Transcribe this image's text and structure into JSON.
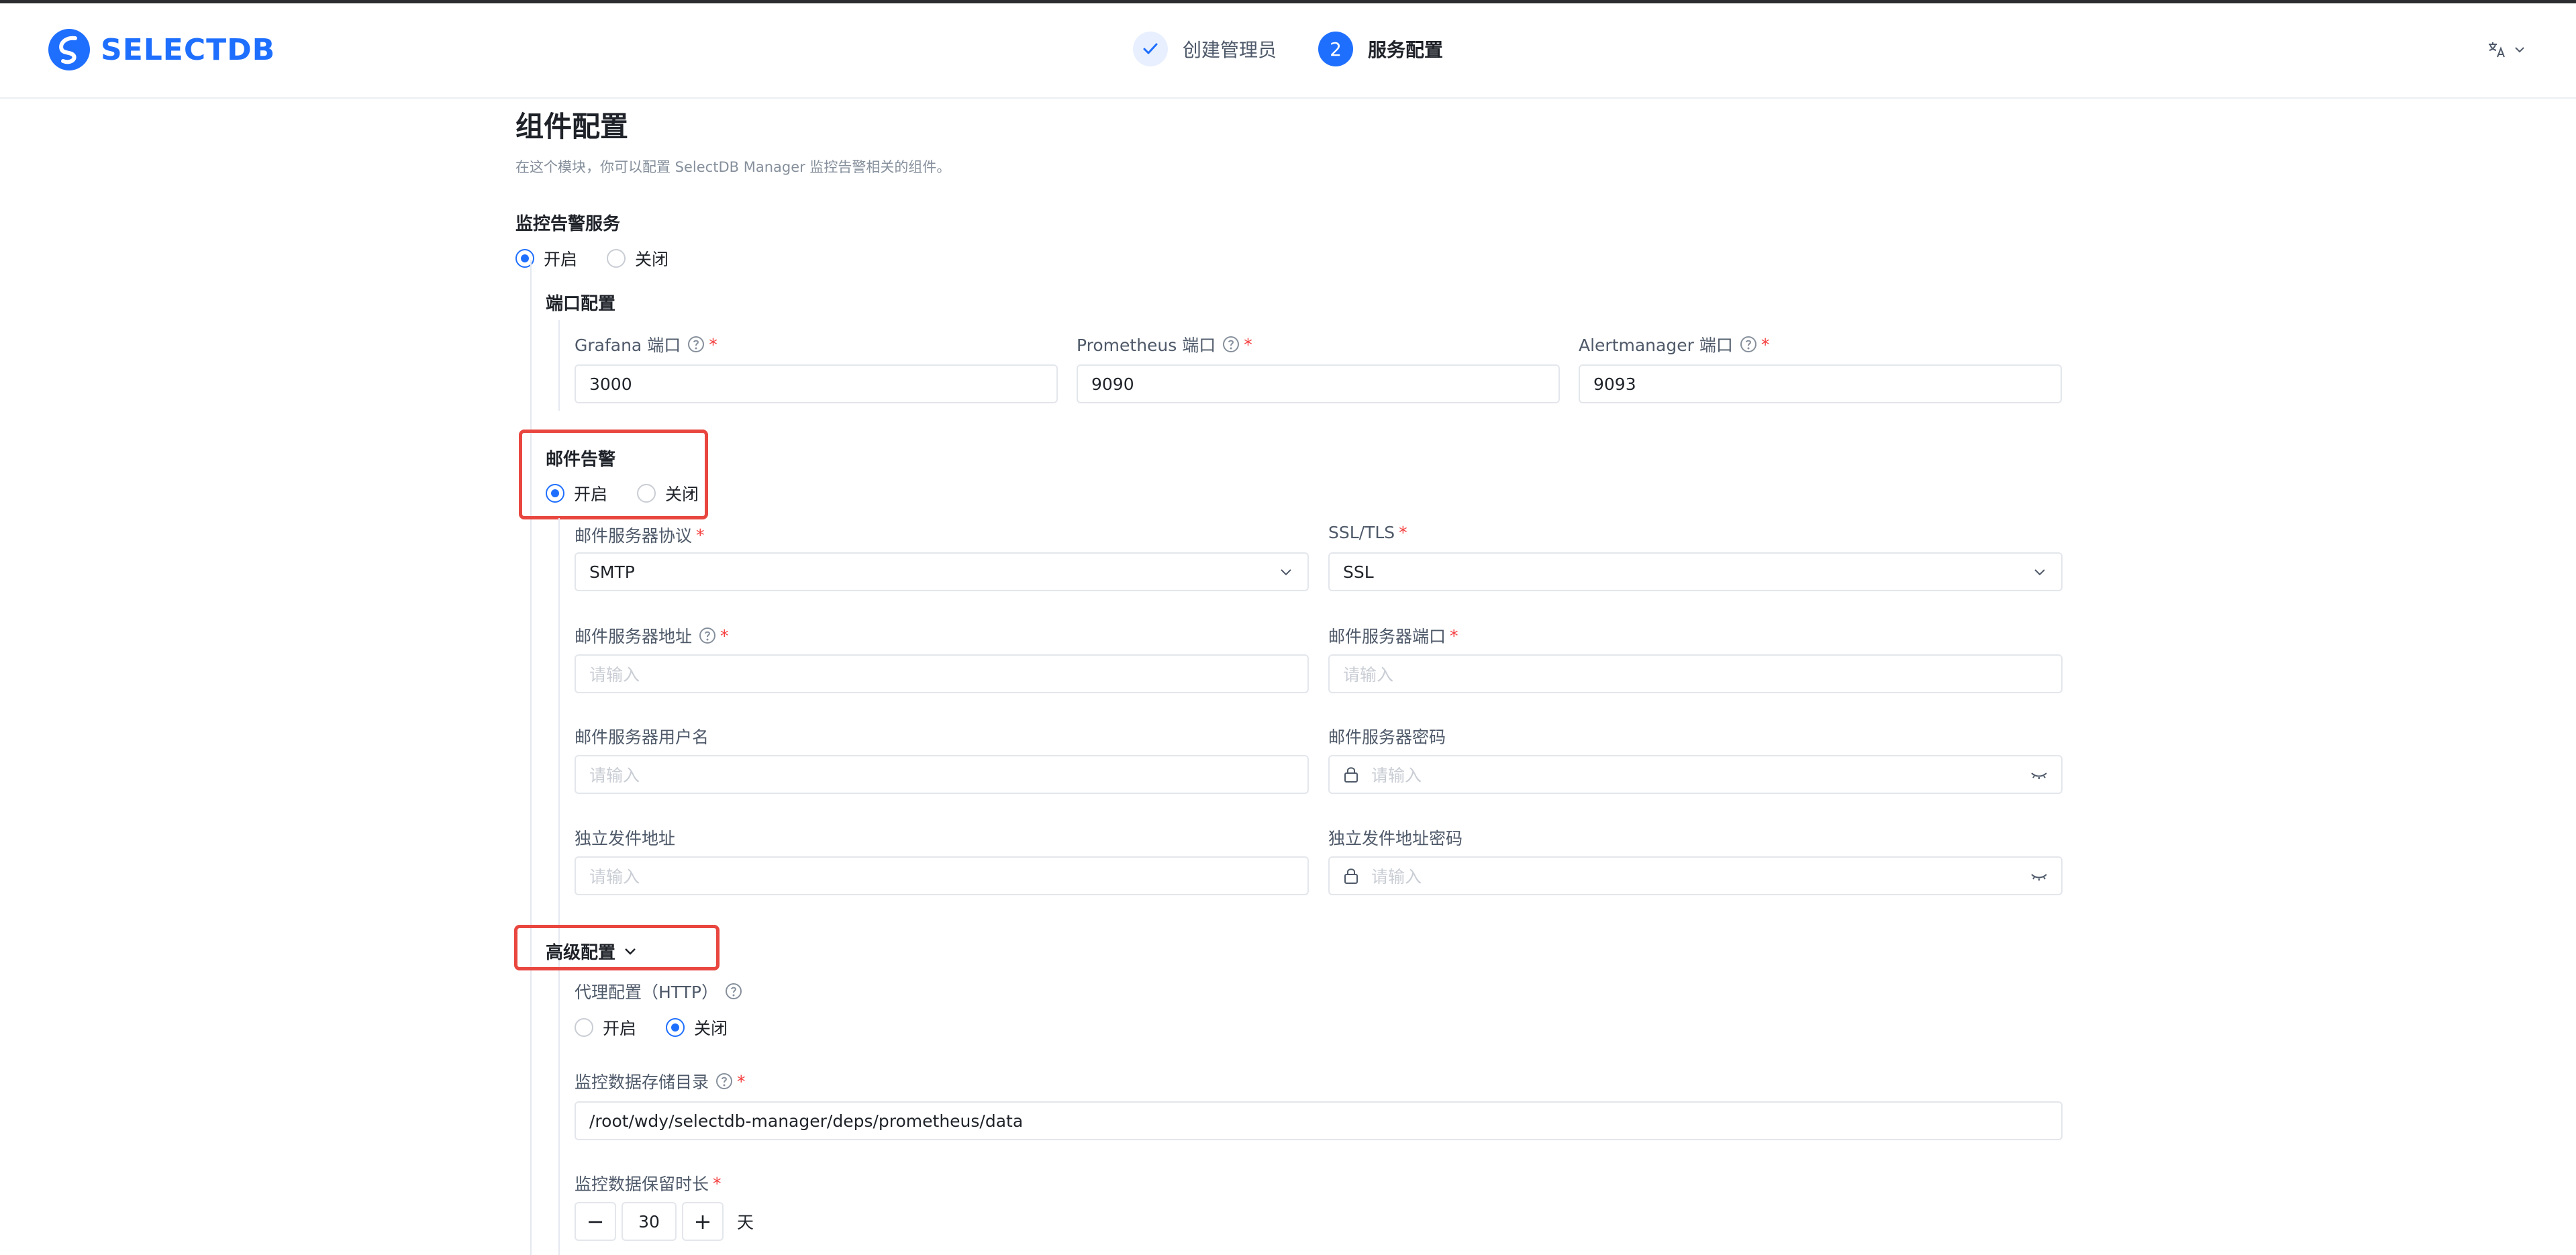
{
  "brand": {
    "name": "SELECTDB",
    "color": "#1f6fff"
  },
  "steps": [
    {
      "number": "",
      "label": "创建管理员",
      "status": "done"
    },
    {
      "number": "2",
      "label": "服务配置",
      "status": "current"
    }
  ],
  "lang_icon": "translate-icon",
  "page": {
    "title": "组件配置",
    "description": "在这个模块，你可以配置 SelectDB Manager 监控告警相关的组件。"
  },
  "monitoring": {
    "label": "监控告警服务",
    "options": [
      "开启",
      "关闭"
    ],
    "selected": "开启",
    "ports": {
      "label": "端口配置",
      "grafana": {
        "label": "Grafana 端口",
        "value": "3000"
      },
      "prometheus": {
        "label": "Prometheus 端口",
        "value": "9090"
      },
      "alertmanager": {
        "label": "Alertmanager 端口",
        "value": "9093"
      }
    }
  },
  "email_alert": {
    "label": "邮件告警",
    "options": [
      "开启",
      "关闭"
    ],
    "selected": "开启",
    "protocol": {
      "label": "邮件服务器协议",
      "value": "SMTP"
    },
    "ssl": {
      "label": "SSL/TLS",
      "value": "SSL"
    },
    "server_address": {
      "label": "邮件服务器地址",
      "placeholder": "请输入"
    },
    "server_port": {
      "label": "邮件服务器端口",
      "placeholder": "请输入"
    },
    "username": {
      "label": "邮件服务器用户名",
      "placeholder": "请输入"
    },
    "password": {
      "label": "邮件服务器密码",
      "placeholder": "请输入"
    },
    "sender_address": {
      "label": "独立发件地址",
      "placeholder": "请输入"
    },
    "sender_password": {
      "label": "独立发件地址密码",
      "placeholder": "请输入"
    }
  },
  "advanced": {
    "label": "高级配置",
    "proxy": {
      "label": "代理配置（HTTP）",
      "options": [
        "开启",
        "关闭"
      ],
      "selected": "关闭"
    },
    "storage_dir": {
      "label": "监控数据存储目录",
      "value": "/root/wdy/selectdb-manager/deps/prometheus/data"
    },
    "retention": {
      "label": "监控数据保留时长",
      "value": "30",
      "unit": "天",
      "minus": "−",
      "plus": "+"
    }
  },
  "colors": {
    "accent": "#1f6fff",
    "highlight": "#e8463f",
    "required": "#f53f3f"
  }
}
